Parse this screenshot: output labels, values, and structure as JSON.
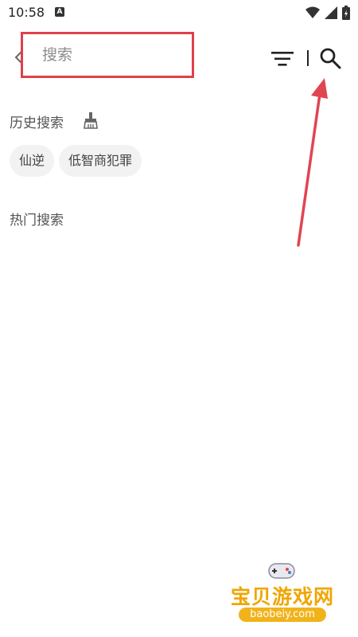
{
  "status_bar": {
    "time": "10:58",
    "notification_badge": "A",
    "icons": [
      "wifi-icon",
      "signal-icon",
      "battery-icon"
    ]
  },
  "header": {
    "search_placeholder": "搜索",
    "back_icon": "chevron-left-icon",
    "filter_icon": "filter-icon",
    "search_icon": "search-icon"
  },
  "history": {
    "title": "历史搜索",
    "clear_icon": "broom-icon",
    "tags": [
      "仙逆",
      "低智商犯罪"
    ]
  },
  "hot": {
    "title": "热门搜索"
  },
  "watermark": {
    "title": "宝贝游戏网",
    "url": "baobeiy.com"
  },
  "colors": {
    "highlight_box": "#e0404a",
    "annotation_arrow": "#e04552",
    "tag_background": "#f2f2f2"
  }
}
